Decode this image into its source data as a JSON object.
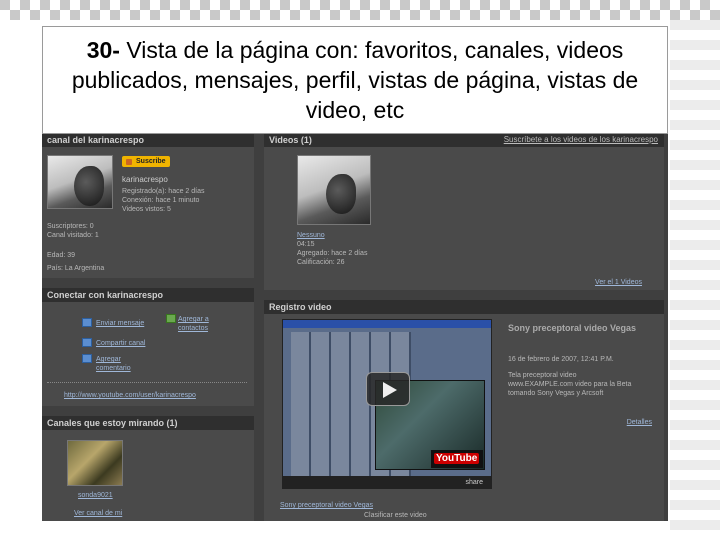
{
  "slide": {
    "title_number": "30-",
    "title_text": "Vista de la página con: favoritos, canales, videos publicados, mensajes, perfil, vistas de página, vistas de video, etc"
  },
  "channel_panel": {
    "heading": "canal del karinacrespo",
    "subscribe_label": "Suscribe",
    "username": "karinacrespo",
    "line1": "Registrado(a): hace 2 días",
    "line2": "Conexión: hace 1 minuto",
    "line3": "Videos vistos: 5",
    "subscribers": "Suscriptores: 0",
    "channel_views": "Canal visitado: 1",
    "age": "Edad: 39",
    "country": "País: La Argentina"
  },
  "videos_panel": {
    "heading": "Videos (1)",
    "right_link": "Suscríbete a los videos de los karinacrespo",
    "video_title": "Nessuno",
    "video_time": "04:15",
    "video_added": "Agregado: hace 2 días",
    "video_views": "Calificación: 26",
    "see_all": "Ver el 1 Videos"
  },
  "connect_panel": {
    "heading": "Conectar con karinacrespo",
    "send_message": "Enviar mensaje",
    "add_contact": "Agregar a contactos",
    "share_channel": "Compartir canal",
    "add_comment": "Agregar comentario",
    "url": "http://www.youtube.com/user/karinacrespo"
  },
  "record_panel": {
    "heading": "Registro video",
    "video_title": "Sony preceptoral video Vegas",
    "date": "16 de febrero de 2007, 12:41 P.M.",
    "desc1": "Tela preceptoral video",
    "desc2": "www.EXAMPLE.com video para la Beta",
    "desc3": "tomando Sony Vegas y Arcsoft",
    "more": "Detalles",
    "share": "share",
    "bottom_title": "Sony preceptoral video Vegas",
    "bottom_sub": "Clasificar este video",
    "logo": "YouTube"
  },
  "watching_panel": {
    "heading": "Canales que estoy mirando (1)",
    "channel_name": "sonda9021",
    "channel_link": "Ver canal de mi"
  },
  "colors": {
    "slide_bg": "#ffffff",
    "page_bg": "#3f3f3f",
    "panel_bg": "#4a4a4a",
    "panel_head": "#2f2f2f",
    "accent_subscribe": "#f0b400"
  }
}
